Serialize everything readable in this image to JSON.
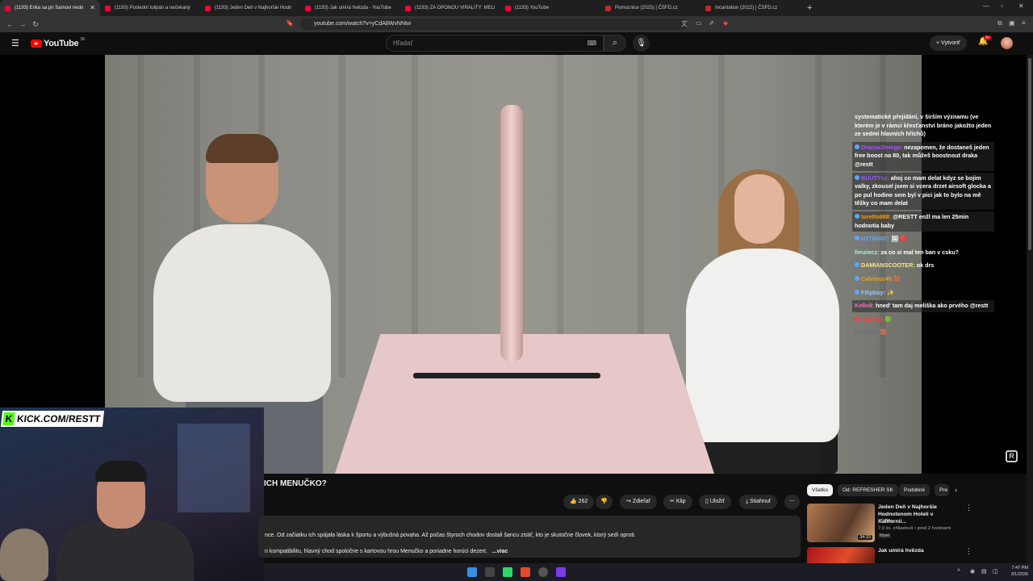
{
  "browser": {
    "tabs": [
      {
        "label": "(1193) Enka sa pri Samovi nedo",
        "kind": "yt"
      },
      {
        "label": "(1193) Poslední tulipán a nečekaný",
        "kind": "yt"
      },
      {
        "label": "(1193) Jeden Deň v Najhoršie Hodn",
        "kind": "yt"
      },
      {
        "label": "(1193) Jak umírá hvězda - YouTube",
        "kind": "yt"
      },
      {
        "label": "(1193) ZA OPONOU VIRALITY: MELI",
        "kind": "yt"
      },
      {
        "label": "(1193) YouTube",
        "kind": "yt"
      },
      {
        "label": "Pomocnice (2025) | ČSFD.cz",
        "kind": "csfd"
      },
      {
        "label": "Incantation (2022) | ČSFD.cz",
        "kind": "csfd"
      }
    ],
    "url": "youtube.com/watch?v=yCdA8WvNNtw"
  },
  "header": {
    "logo": "YouTube",
    "region": "SK",
    "search_placeholder": "Hľadať",
    "create_label": "Vytvoriť",
    "notif_count": "9+"
  },
  "chat": [
    {
      "nick": "",
      "text": "systematické přejídání, v širším významu (ve kterém je v rámci křesťanství bráno jakožto jeden ze sedmi hlavních hříchů)",
      "color": "#ffffff",
      "hl": false
    },
    {
      "nick": "DracoxOmega:",
      "text": "nezapomen, že dostaneš jeden free boost na 80, tak můžeš boostnout draka @restt",
      "color": "#a855f7",
      "hl": true
    },
    {
      "nick": "BUUTYcz:",
      "text": "ahoj co mam delat kdyz se bojim valky, zkousel jsem si vcera drzet airsoft glocka a po pul hodine sem byl v pici jak to bylo na mě těžky co mam delat",
      "color": "#8b5cf6",
      "hl": true
    },
    {
      "nick": "toretto888:",
      "text": "@RESTT enžl ma len 25min hodnotia baby",
      "color": "#f59e0b",
      "hl": true
    },
    {
      "nick": "H1TM4N7:",
      "text": "",
      "color": "#60a5fa",
      "hl": false
    },
    {
      "nick": "fenziecz:",
      "text": "za co si mal ten ban v csku?",
      "color": "#a7f3d0",
      "hl": false
    },
    {
      "nick": "DAMIANSCOOTER:",
      "text": "ok drs",
      "color": "#fde68a",
      "hl": false
    },
    {
      "nick": "Calvinos45",
      "text": "",
      "color": "#f59e0b",
      "hl": false
    },
    {
      "nick": "Filipboy:",
      "text": "",
      "color": "#93c5fd",
      "hl": false
    },
    {
      "nick": "Kello8:",
      "text": "hned' tam daj meliška ako prvého @restt",
      "color": "#f472b6",
      "hl": true
    },
    {
      "nick": "AiWeN3",
      "text": "",
      "color": "#ef4444",
      "hl": false
    },
    {
      "nick": "Mathody",
      "text": "",
      "color": "#6b7280",
      "hl": false
    }
  ],
  "webcam": {
    "kick_label": "KICK.COM/RESTT"
  },
  "video": {
    "title": "ICH MENUČKO?",
    "likes": "262",
    "actions": {
      "share": "Zdieľať",
      "clip": "Klip",
      "save": "Uložiť",
      "download": "Stiahnuť"
    },
    "description_line1": "nce. Od začiatku ich spájala láska k športu a výbušná povaha. Až počas štyroch chodov dostali šancu zistiť, kto je skutočne človek, ktorý sedí oproti.",
    "description_line2": "n kompatibilitu, hlavný chod spoločne s kartovou hrou Menučko a poriadne horúci dezert.",
    "more": "...viac"
  },
  "chips": [
    "Všetko",
    "Od: REFRESHER SK",
    "Podobné",
    "Pre"
  ],
  "recommendations": [
    {
      "title": "Jeden Deň v Najhoršie Hodnotenom Hoteli v Kalifornii...",
      "channel": "PPPter",
      "meta": "7,6 tis. zhliadnutí • pred 2 hodinami",
      "badge": "Nové",
      "duration": "34:15"
    },
    {
      "title": "Jak umírá hvězda",
      "channel": "",
      "meta": "",
      "badge": "",
      "duration": ""
    }
  ],
  "taskbar": {
    "time": "7:47 PM",
    "date": "3/1/2026"
  }
}
